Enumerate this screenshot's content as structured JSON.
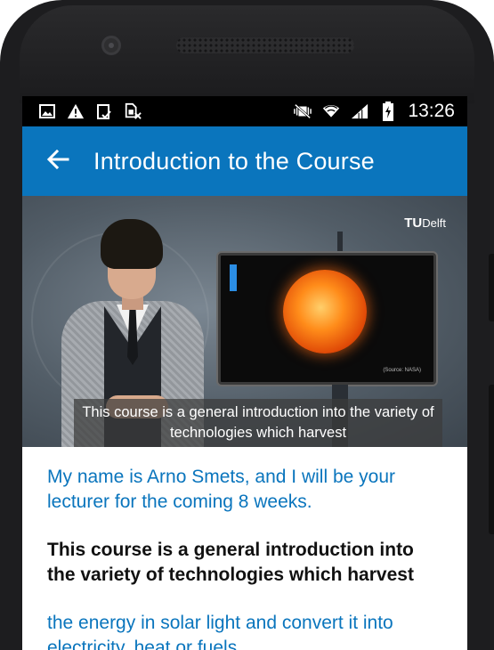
{
  "status_bar": {
    "time": "13:26",
    "left_icons": [
      "image-icon",
      "warning-icon",
      "clipboard-check-icon",
      "no-sim-icon"
    ],
    "right_icons": [
      "vibrate-mute-icon",
      "wifi-icon",
      "signal-icon",
      "battery-icon"
    ]
  },
  "app_bar": {
    "title": "Introduction to the Course",
    "background": "#0a75bd"
  },
  "video": {
    "logo_prefix": "TU",
    "logo_suffix": "Delft",
    "monitor_credit": "(Source: NASA)",
    "caption": "This course is a general introduction into the variety of technologies which harvest"
  },
  "transcript": {
    "lines": [
      "My name is Arno Smets, and I will be your lecturer for the coming 8 weeks.",
      "This course is a general introduction into the variety of technologies which harvest",
      "the energy in solar light and convert it into electricity, heat or fuels."
    ],
    "active_index": 1,
    "accent_color": "#0a75bd"
  }
}
